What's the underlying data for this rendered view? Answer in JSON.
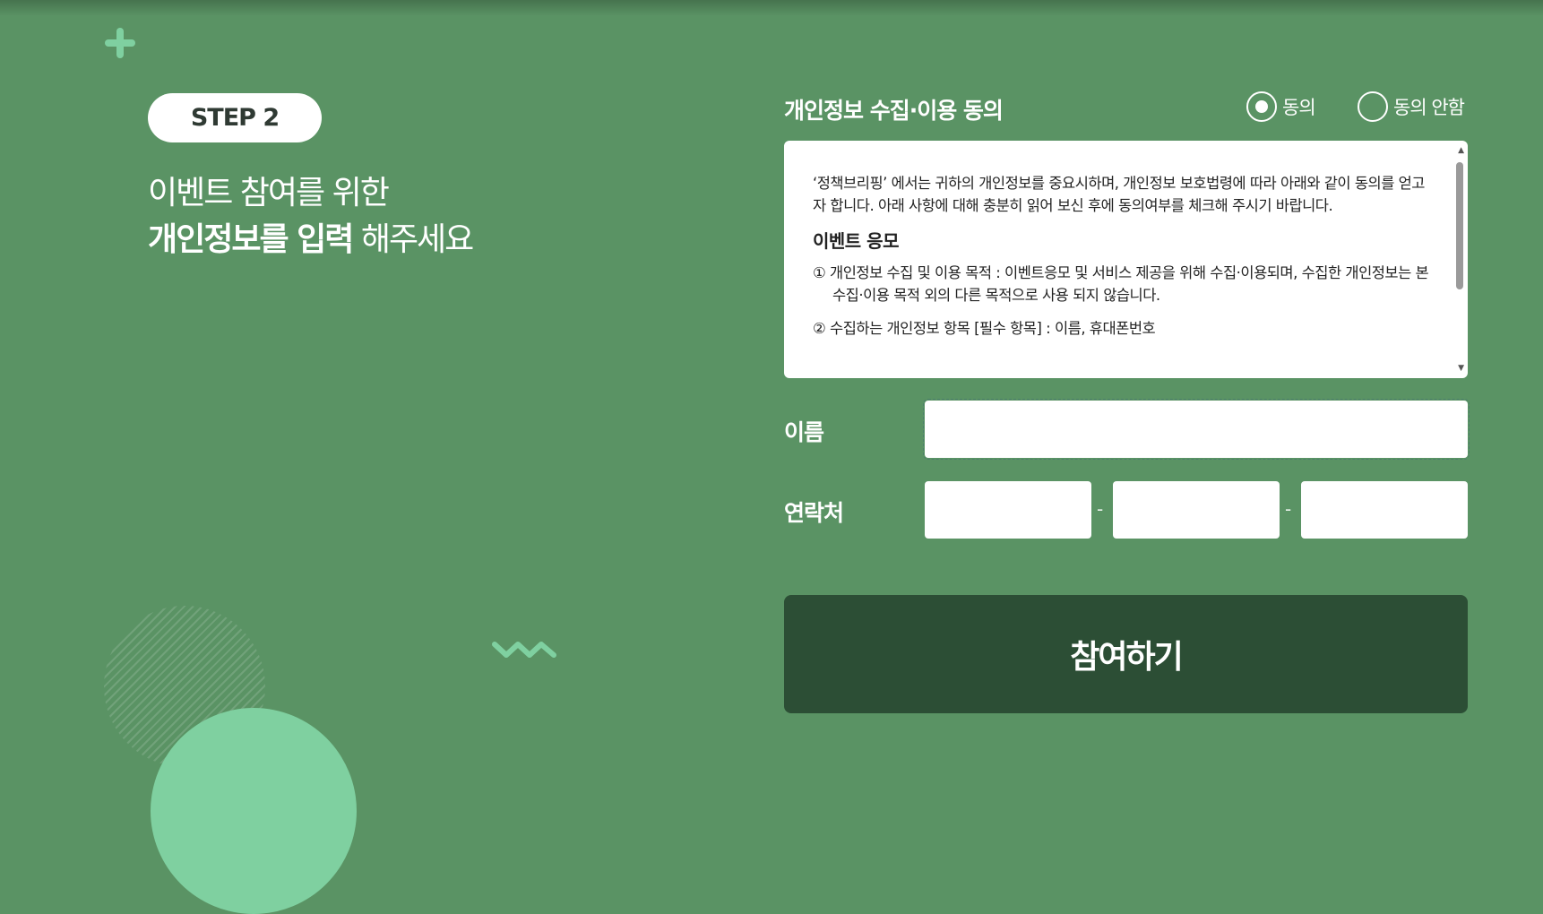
{
  "step": {
    "badge": "STEP 2"
  },
  "headline": {
    "line1": "이벤트 참여를 위한",
    "line2_bold": "개인정보를 입력",
    "line2_rest": " 해주세요"
  },
  "consent": {
    "title": "개인정보 수집·이용 동의",
    "options": [
      {
        "label": "동의",
        "selected": true
      },
      {
        "label": "동의 안함",
        "selected": false
      }
    ],
    "terms": {
      "intro": "‘정책브리핑’ 에서는 귀하의 개인정보를 중요시하며, 개인정보 보호법령에 따라 아래와 같이 동의를 얻고자 합니다. 아래 사항에 대해 충분히 읽어 보신 후에 동의여부를 체크해 주시기 바랍니다.",
      "heading": "이벤트 응모",
      "items": [
        "① 개인정보 수집 및 이용 목적 : 이벤트응모 및 서비스 제공을 위해 수집·이용되며, 수집한 개인정보는 본 수집·이용 목적 외의 다른 목적으로 사용 되지 않습니다.",
        "② 수집하는 개인정보 항목 [필수 항목] : 이름, 휴대폰번호"
      ]
    }
  },
  "form": {
    "name_label": "이름",
    "name_value": "",
    "phone_label": "연락처",
    "phone_parts": [
      "",
      "",
      ""
    ],
    "separator": "-"
  },
  "submit": {
    "label": "참여하기"
  },
  "colors": {
    "background": "#5a9364",
    "accent": "#7fd0a0",
    "button": "#2c4e35"
  },
  "icons": {
    "plus": "plus-icon",
    "wave": "zigzag-icon"
  }
}
